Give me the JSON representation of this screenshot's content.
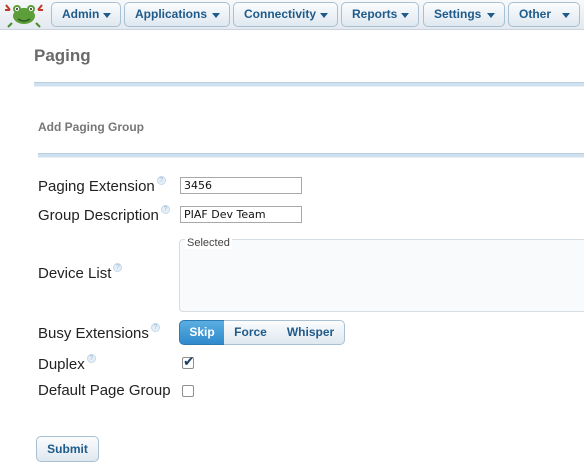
{
  "nav": {
    "menus": [
      "Admin",
      "Applications",
      "Connectivity",
      "Reports",
      "Settings",
      "Other"
    ]
  },
  "page": {
    "title": "Paging"
  },
  "form": {
    "section_title": "Add Paging Group",
    "paging_extension": {
      "label": "Paging Extension",
      "value": "3456"
    },
    "group_description": {
      "label": "Group Description",
      "value": "PIAF Dev Team"
    },
    "device_list": {
      "label": "Device List",
      "legend": "Selected"
    },
    "busy_extensions": {
      "label": "Busy Extensions",
      "options": [
        "Skip",
        "Force",
        "Whisper"
      ],
      "selected": "Skip"
    },
    "duplex": {
      "label": "Duplex",
      "checked": true
    },
    "default_page_group": {
      "label": "Default Page Group",
      "checked": false
    },
    "submit_label": "Submit"
  },
  "colors": {
    "accent": "#2f8acc",
    "nav_text": "#1f5b8a",
    "separator": "#cfe1ee"
  },
  "icons": {
    "logo": "frog-logo-icon",
    "help": "help-icon",
    "dropdown": "caret-down-icon",
    "check": "checkmark-icon"
  }
}
